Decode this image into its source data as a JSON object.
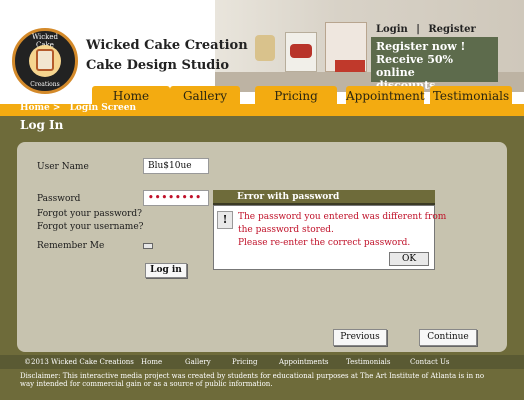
{
  "brand": {
    "logo_top": "Wicked Cake",
    "logo_bottom": "Creations",
    "line1": "Wicked Cake Creation",
    "line2": "Cake Design Studio"
  },
  "top_links": {
    "login": "Login",
    "sep": "|",
    "register": "Register"
  },
  "promo": {
    "line1": "Register now !",
    "line2": "Receive  50% online",
    "line3": "discounts."
  },
  "nav": {
    "home": "Home",
    "gallery": "Gallery",
    "pricing": "Pricing",
    "appointment": "Appointment",
    "testimonials": "Testimonials"
  },
  "breadcrumb": {
    "home": "Home >",
    "current": "Login Screen"
  },
  "page_title": "Log In",
  "form": {
    "username_label": "User Name",
    "username_value": "Blu$10ue",
    "password_label": "Password",
    "password_value": "••••••••",
    "forgot_password": "Forgot your password?",
    "forgot_username": "Forgot your username?",
    "remember_me": "Remember Me",
    "login_button": "Log in"
  },
  "error_dialog": {
    "title": "Error with password",
    "icon": "!",
    "line1": "The password you entered was different from",
    "line2": "the password stored.",
    "line3": "Please re-enter the correct password.",
    "ok": "OK"
  },
  "pager": {
    "previous": "Previous",
    "continue": "Continue"
  },
  "footer": {
    "copyright": "©2013 Wicked Cake Creations",
    "home": "Home",
    "gallery": "Gallery",
    "pricing": "Pricing",
    "appointments": "Appointments",
    "testimonials": "Testimonials",
    "contact": "Contact Us",
    "disclaimer": "Disclaimer: This interactive media project was created by students for educational purposes at The Art Institute of Atlanta is in no way intended for commercial gain or as a source of public information."
  },
  "colors": {
    "nav_orange": "#f3ab11",
    "olive": "#6e6b3a",
    "panel": "#c7c3af",
    "error_red": "#c0122a",
    "promo_green": "#5d6b4c"
  },
  "icons": [
    "logo-badge",
    "warning-icon"
  ]
}
